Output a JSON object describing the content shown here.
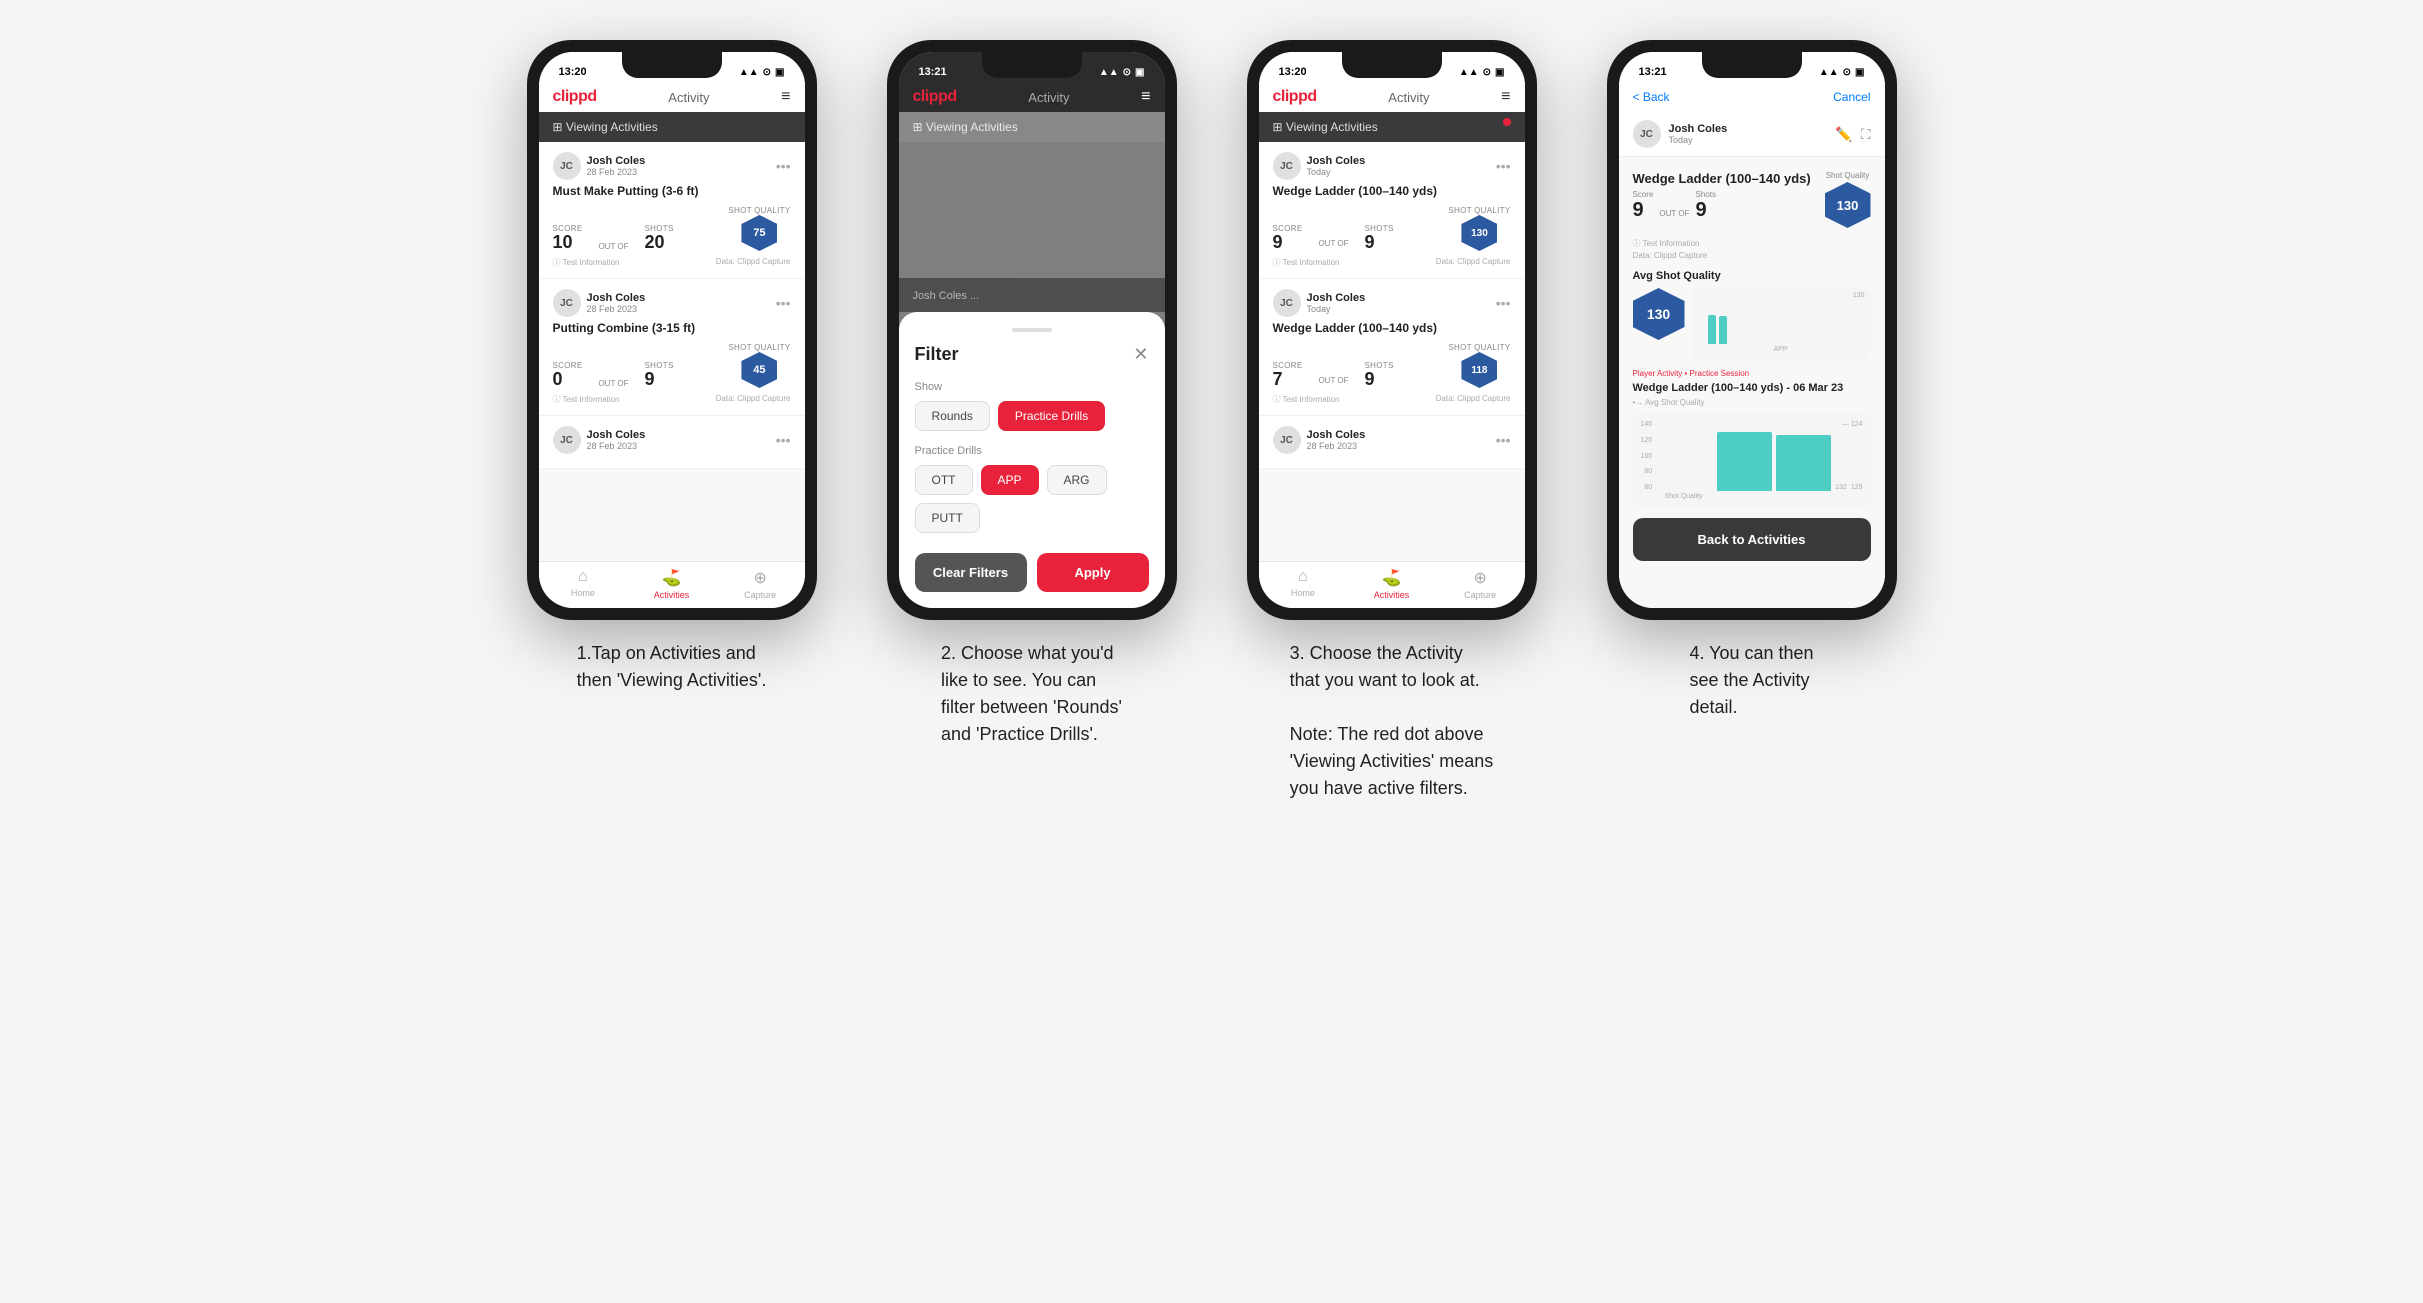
{
  "page": {
    "background": "#f5f5f7"
  },
  "phone1": {
    "status_time": "13:20",
    "status_icons": "▲ ⊙ ▣",
    "logo": "clippd",
    "header_title": "Activity",
    "header_menu": "≡",
    "viewing_bar": "⊞ Viewing Activities",
    "has_red_dot": false,
    "cards": [
      {
        "user_name": "Josh Coles",
        "user_date": "28 Feb 2023",
        "title": "Must Make Putting (3-6 ft)",
        "score_label": "Score",
        "score_value": "10",
        "shots_label": "Shots",
        "shots_outof": "20",
        "quality_value": "75",
        "footer_left": "ⓘ Test Information",
        "footer_right": "Data: Clippd Capture"
      },
      {
        "user_name": "Josh Coles",
        "user_date": "28 Feb 2023",
        "title": "Putting Combine (3-15 ft)",
        "score_label": "Score",
        "score_value": "0",
        "shots_label": "Shots",
        "shots_outof": "9",
        "quality_value": "45",
        "footer_left": "ⓘ Test Information",
        "footer_right": "Data: Clippd Capture"
      },
      {
        "user_name": "Josh Coles",
        "user_date": "28 Feb 2023",
        "title": "",
        "score_label": "",
        "score_value": "",
        "shots_label": "",
        "shots_outof": "",
        "quality_value": "",
        "footer_left": "",
        "footer_right": ""
      }
    ],
    "nav_items": [
      "Home",
      "Activities",
      "Capture"
    ],
    "nav_active": 1
  },
  "phone2": {
    "status_time": "13:21",
    "logo": "clippd",
    "header_title": "Activity",
    "viewing_bar": "⊞ Viewing Activities",
    "filter_title": "Filter",
    "show_label": "Show",
    "show_options": [
      "Rounds",
      "Practice Drills"
    ],
    "show_active": 1,
    "practice_drills_label": "Practice Drills",
    "drill_filters": [
      "OTT",
      "APP",
      "ARG",
      "PUTT"
    ],
    "active_drills": [
      1
    ],
    "clear_label": "Clear Filters",
    "apply_label": "Apply",
    "nav_items": [
      "Home",
      "Activities",
      "Capture"
    ],
    "nav_active": 1
  },
  "phone3": {
    "status_time": "13:20",
    "logo": "clippd",
    "header_title": "Activity",
    "viewing_bar": "⊞ Viewing Activities",
    "has_red_dot": true,
    "cards": [
      {
        "user_name": "Josh Coles",
        "user_date": "Today",
        "title": "Wedge Ladder (100–140 yds)",
        "score_label": "Score",
        "score_value": "9",
        "shots_label": "Shots",
        "shots_outof": "9",
        "quality_value": "130",
        "footer_left": "ⓘ Test Information",
        "footer_right": "Data: Clippd Capture"
      },
      {
        "user_name": "Josh Coles",
        "user_date": "Today",
        "title": "Wedge Ladder (100–140 yds)",
        "score_label": "Score",
        "score_value": "7",
        "shots_label": "Shots",
        "shots_outof": "9",
        "quality_value": "118",
        "footer_left": "ⓘ Test Information",
        "footer_right": "Data: Clippd Capture"
      },
      {
        "user_name": "Josh Coles",
        "user_date": "28 Feb 2023",
        "title": "",
        "score_label": "",
        "score_value": "",
        "shots_label": "",
        "shots_outof": "",
        "quality_value": "",
        "footer_left": "",
        "footer_right": ""
      }
    ],
    "nav_items": [
      "Home",
      "Activities",
      "Capture"
    ],
    "nav_active": 1
  },
  "phone4": {
    "status_time": "13:21",
    "back_label": "< Back",
    "cancel_label": "Cancel",
    "user_name": "Josh Coles",
    "user_date": "Today",
    "drill_title": "Wedge Ladder (100–140 yds)",
    "score_col": "Score",
    "shots_col": "Shots",
    "score_value": "9",
    "shots_outof": "9",
    "quality_label": "OUT OF",
    "hex_value": "130",
    "avg_quality_label": "Avg Shot Quality",
    "chart_bars": [
      132,
      129,
      124
    ],
    "chart_max": 140,
    "sub_label": "ⓘ Test Information",
    "sub_label2": "Data: Clippd Capture",
    "player_activity_label": "Player Activity • Practice Session",
    "session_title": "Wedge Ladder (100–140 yds) - 06 Mar 23",
    "session_subtitle": "•→ Avg Shot Quality",
    "y_labels": [
      "140",
      "120",
      "100",
      "80",
      "60"
    ],
    "back_to_activities": "Back to Activities"
  },
  "captions": [
    "1.Tap on Activities and\nthen 'Viewing Activities'.",
    "2. Choose what you'd\nlike to see. You can\nfilter between 'Rounds'\nand 'Practice Drills'.",
    "3. Choose the Activity\nthat you want to look at.\n\nNote: The red dot above\n'Viewing Activities' means\nyou have active filters.",
    "4. You can then\nsee the Activity\ndetail."
  ]
}
